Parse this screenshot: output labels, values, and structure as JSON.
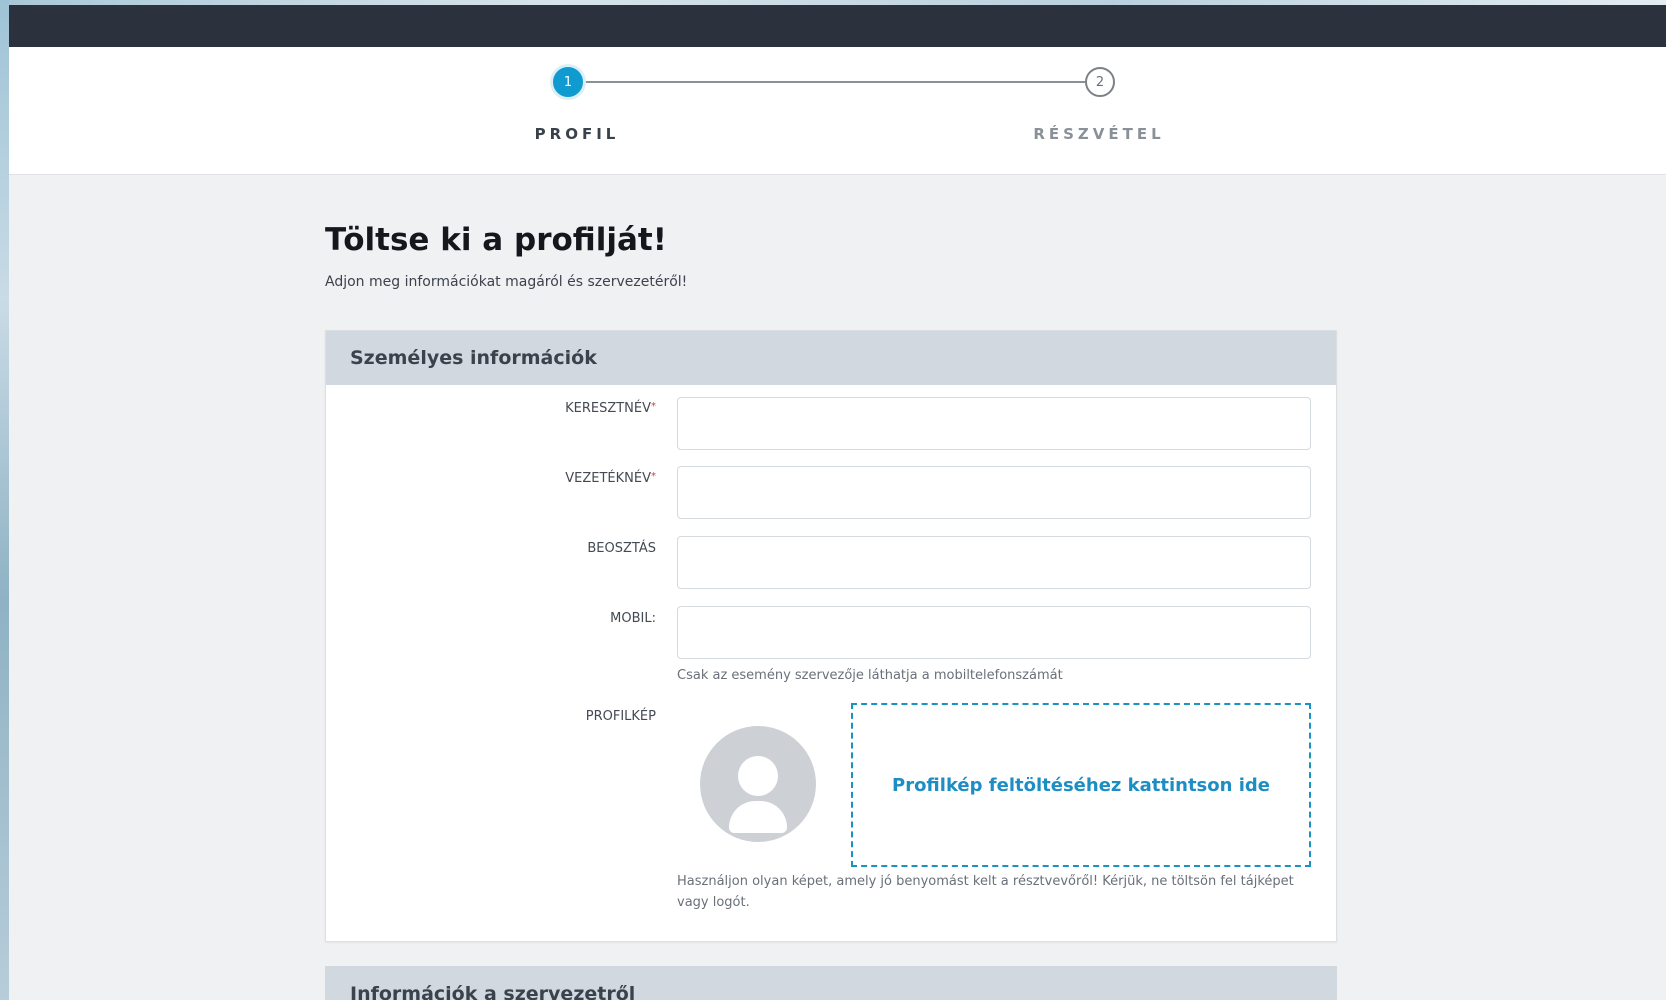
{
  "stepper": {
    "steps": [
      {
        "number": "1",
        "label": "PROFIL",
        "state": "active"
      },
      {
        "number": "2",
        "label": "RÉSZVÉTEL",
        "state": "inactive"
      }
    ],
    "active_color": "#0f9bd0"
  },
  "page": {
    "title": "Töltse ki a profilját!",
    "subtitle": "Adjon meg információkat magáról és szervezetéről!"
  },
  "personal_section": {
    "header": "Személyes információk",
    "fields": {
      "first_name": {
        "label": "KERESZTNÉV",
        "required_mark": "*",
        "value": ""
      },
      "last_name": {
        "label": "VEZETÉKNÉV",
        "required_mark": "*",
        "value": ""
      },
      "position": {
        "label": "BEOSZTÁS",
        "value": ""
      },
      "mobile": {
        "label": "MOBIL:",
        "value": "",
        "helper": "Csak az esemény szervezője láthatja a mobiltelefonszámát"
      },
      "profile_image": {
        "label": "PROFILKÉP",
        "upload_text": "Profilkép feltöltéséhez kattintson ide",
        "helper": "Használjon olyan képet, amely jó benyomást kelt a résztvevőről! Kérjük, ne töltsön fel tájképet vagy logót."
      }
    }
  },
  "organization_section": {
    "header": "Információk a szervezetről"
  },
  "icons": {
    "avatar_placeholder": "user-silhouette-icon"
  }
}
